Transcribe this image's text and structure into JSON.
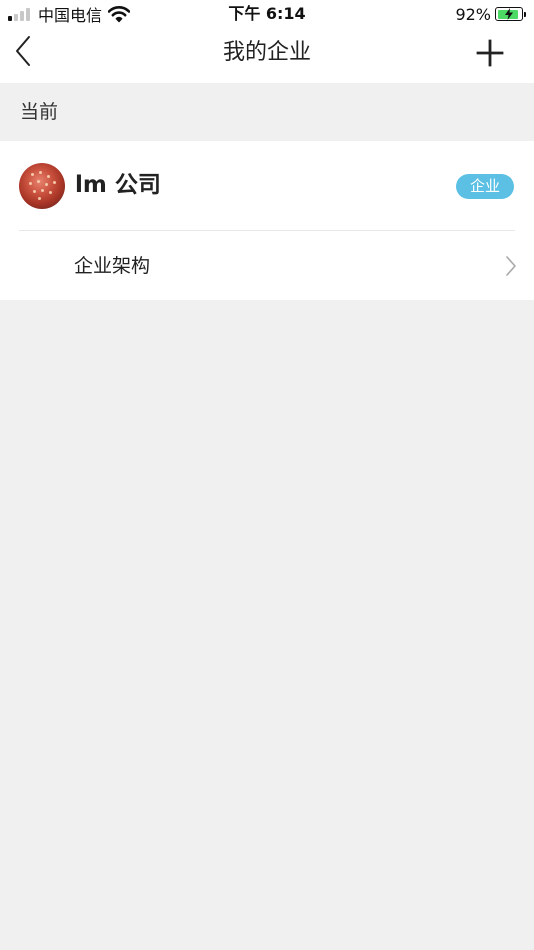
{
  "status_bar": {
    "carrier": "中国电信",
    "time": "下午 6:14",
    "battery_percent": "92%",
    "battery_level": 0.92,
    "signal_icon": "signal-bars-icon",
    "wifi_icon": "wifi-icon",
    "battery_icon": "battery-charging-icon"
  },
  "nav": {
    "title": "我的企业",
    "back_icon": "chevron-left-icon",
    "add_icon": "plus-icon"
  },
  "section": {
    "label": "当前"
  },
  "company": {
    "name": "lm 公司",
    "badge": "企业",
    "badge_color": "#5bc0e4",
    "avatar_icon": "company-avatar"
  },
  "structure": {
    "label": "企业架构",
    "chevron_icon": "chevron-right-icon"
  },
  "colors": {
    "background": "#f0f0f0",
    "surface": "#ffffff",
    "battery_fill": "#4cd964"
  }
}
